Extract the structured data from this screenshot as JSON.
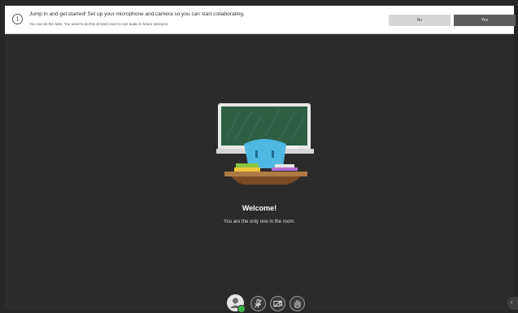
{
  "banner": {
    "title": "Jump in and get started! Set up your microphone and camera so you can start collaborating.",
    "subtitle": "You can do this later. You need to do this at least once to use audio in future sessions.",
    "no_label": "No",
    "yes_label": "Yes"
  },
  "main": {
    "welcome_heading": "Welcome!",
    "welcome_message": "You are the only one in the room."
  },
  "colors": {
    "background": "#2b2b2b",
    "banner": "#ffffff",
    "yes_button": "#5d5d5d",
    "no_button": "#d7d7d7",
    "status_online": "#3fb54a",
    "chalkboard": "#2f5e45",
    "chair": "#4fb8e3"
  },
  "controls": {
    "icons": [
      "avatar-icon",
      "microphone-icon",
      "camera-icon",
      "hand-raise-icon"
    ]
  },
  "collab_panel_icon": "chevron-left-icon"
}
